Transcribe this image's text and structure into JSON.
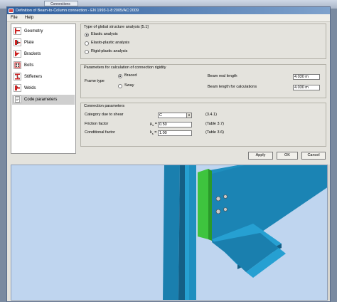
{
  "background_tab": {
    "label": "Connections"
  },
  "window": {
    "title": "Definition of Beam-to-Column connection - EN 1993-1-8:2005/AC:2009"
  },
  "menu": {
    "file": "File",
    "help": "Help"
  },
  "nav": [
    {
      "label": "Geometry",
      "icon": "geometry-icon"
    },
    {
      "label": "Plate",
      "icon": "plate-icon"
    },
    {
      "label": "Brackets",
      "icon": "brackets-icon"
    },
    {
      "label": "Bolts",
      "icon": "bolts-icon"
    },
    {
      "label": "Stiffeners",
      "icon": "stiffeners-icon"
    },
    {
      "label": "Welds",
      "icon": "welds-icon"
    },
    {
      "label": "Code parameters",
      "icon": "code-parameters-icon"
    }
  ],
  "nav_selected": "Code parameters",
  "global_analysis": {
    "title": "Type of global structure analysis [5.1]",
    "options": [
      "Elastic analysis",
      "Elasto-plastic analysis",
      "Rigid-plastic analysis"
    ],
    "selected": "Elastic analysis"
  },
  "rigidity": {
    "title": "Parameters for calculation of connection rigidity",
    "frame_type_label": "Frame type",
    "options": [
      "Braced",
      "Sway"
    ],
    "selected": "Braced",
    "beam_real_length_label": "Beam real length",
    "beam_real_length_value": "4.030 m",
    "beam_calc_length_label": "Beam length for calculations",
    "beam_calc_length_value": "4.030 m"
  },
  "conn_params": {
    "title": "Connection parameters",
    "category_label": "Category due to shear",
    "category_value": "C",
    "category_ref": "(3.4.1)",
    "friction_label": "Friction factor",
    "friction_symbol": "μ",
    "friction_sub": "s",
    "friction_value": "0.50",
    "friction_ref": "(Table 3.7)",
    "conditional_label": "Conditional factor",
    "conditional_symbol": "k",
    "conditional_sub": "s",
    "conditional_value": "1.00",
    "conditional_ref": "(Table 3.6)"
  },
  "buttons": {
    "apply": "Apply",
    "ok": "OK",
    "cancel": "Cancel"
  },
  "colors": {
    "steel": "#1f8fbf",
    "steel_dark": "#145f86",
    "plate": "#3ec43e",
    "viewport_bg": "#bfd5ef",
    "title_bar": "#2f5f9e"
  }
}
